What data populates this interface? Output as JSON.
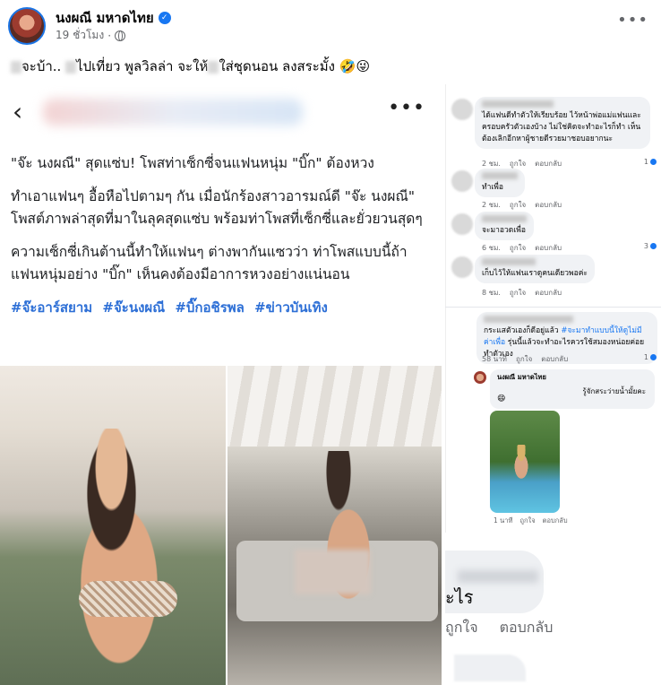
{
  "post": {
    "author": "นงผณี มหาดไทย",
    "time": "19 ชั่วโมง",
    "separator": "·",
    "text_part1": "จะบ้า..",
    "text_part2": "ไปเที่ยว พูลวิลล่า จะให้",
    "text_part3": "ใส่ชุดนอน ลงสระมั้ง 🤣😜",
    "more": "•••"
  },
  "article": {
    "back": "‹",
    "more": "•••",
    "para1": "\"จ๊ะ นงผณี\" สุดแซ่บ! โพสท่าเซ็กซี่จนแฟนหนุ่ม \"บิ๊ก\" ต้องหวง",
    "para2": "ทำเอาแฟนๆ อื้อหือไปตามๆ กัน เมื่อนักร้องสาวอารมณ์ดี \"จ๊ะ นงผณี\" โพสต์ภาพล่าสุดที่มาในลุคสุดแซ่บ พร้อมท่าโพสที่เซ็กซี่และยั่วยวนสุดๆ",
    "para3": "ความเซ็กซี่เกินต้านนี้ทำให้แฟนๆ ต่างพากันแซวว่า ท่าโพสแบบนี้ถ้าแฟนหนุ่มอย่าง \"บิ๊ก\" เห็นคงต้องมีอาการหวงอย่างแน่นอน",
    "hashtags": [
      "#จ๊ะอาร์สยาม",
      "#จ๊ะนงผณี",
      "#บิ๊กอชิรพล",
      "#ข่าวบันเทิง"
    ]
  },
  "comments": [
    {
      "text": "ได้แฟนดีทำตัวให้เรียบร้อย ไว้หน้าพ่อแม่แฟนและครอบครัวตัวเองบ้าง ไม่ใช่คิดจะทำอะไรก็ทำ เห็นต้องเลิกอีกหาผู้ชายดีรวยมาชอบอยากนะ",
      "time": "2 ชม.",
      "like": "ถูกใจ",
      "reply": "ตอบกลับ",
      "reactions": "1"
    },
    {
      "text": "ทำเพื่อ",
      "time": "2 ชม.",
      "like": "ถูกใจ",
      "reply": "ตอบกลับ"
    },
    {
      "text": "จะมาอวดเพื่อ",
      "time": "6 ชม.",
      "like": "ถูกใจ",
      "reply": "ตอบกลับ",
      "reactions": "3"
    },
    {
      "text": "เก็บไว้ให้แฟนเราดูคนเดียวพอค่ะ",
      "time": "8 ชม.",
      "like": "ถูกใจ",
      "reply": "ตอบกลับ"
    },
    {
      "text_black": "กระแสตัวเองก็ดีอยู่แล้ว",
      "text_blue": "#จะมาทำแบบนี้ให้ดูไม่มีค่าเพื่อ",
      "text_rest": "รุ่นนี้แล้วจะทำอะไรควรใช้สมองหน่อยค่อยทำตัวเอง",
      "time": "58 นาที",
      "like": "ถูกใจ",
      "reply": "ตอบกลับ",
      "reactions": "1"
    }
  ],
  "reply": {
    "name": "นงผณี มหาดไทย",
    "text": "รู้จักสระว่ายน้ำมั้ยคะ",
    "emoji": "😄",
    "time": "1 นาที",
    "like": "ถูกใจ",
    "reply": "ตอบกลับ"
  },
  "zoom": {
    "text": "ะไร",
    "like": "ถูกใจ",
    "reply": "ตอบกลับ"
  },
  "colors": {
    "link": "#1877f2",
    "hashtag": "#2d6fd6",
    "verified": "#1877f2"
  }
}
